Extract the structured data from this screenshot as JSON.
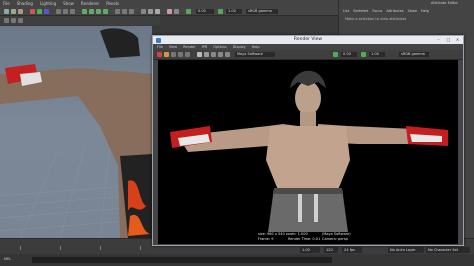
{
  "main_menu": [
    "File",
    "Shading",
    "Lighting",
    "Show",
    "Renderer",
    "Panels"
  ],
  "status_line": {
    "frame_field": "0.00",
    "time_field": "1.00",
    "color_space": "sRGB gamma"
  },
  "shelf": {
    "tabs": [
      "Curves / Surfaces",
      "Poly Modeling",
      "Sculpting",
      "Rigging"
    ]
  },
  "attribute_editor": {
    "title": "Attribute Editor",
    "tabs": [
      "List",
      "Selected",
      "Focus",
      "Attributes",
      "Show",
      "Help"
    ],
    "message": "Make a selection to view attributes"
  },
  "render_view": {
    "title": "Render View",
    "window_buttons": {
      "minimize": "–",
      "maximize": "□",
      "close": "×"
    },
    "menu": [
      "File",
      "View",
      "Render",
      "IPR",
      "Options",
      "Display",
      "Help"
    ],
    "toolbar": {
      "renderer": "Maya Software",
      "frame_field": "0.00",
      "exposure_field": "1.00",
      "color_space": "sRGB gamma"
    },
    "stats": {
      "size": "size: 960 x 540  zoom: 1.000",
      "frame": "Frame: 9",
      "render_time": "Render Time: 0:01",
      "renderer": "(Maya Software)",
      "camera": "Camera: persp"
    }
  },
  "timeline": {
    "start_field": "1.00",
    "end_field": "120",
    "anim_layer": "No Anim Layer",
    "char_set": "No Character Set",
    "fps": "24 fps"
  },
  "bottom_bar": {
    "label": "MEL"
  }
}
